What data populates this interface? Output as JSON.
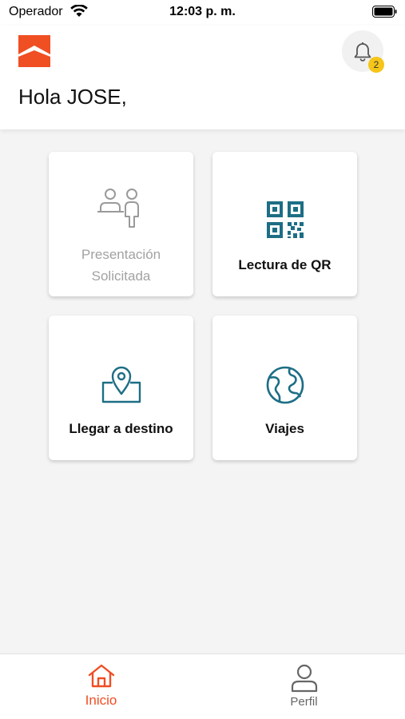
{
  "status_bar": {
    "carrier": "Operador",
    "time": "12:03 p. m."
  },
  "header": {
    "greeting": "Hola JOSE,",
    "notification_count": "2",
    "logo_icon": "brand-logo",
    "notification_icon": "bell-icon"
  },
  "cards": {
    "presentacion": {
      "label_line1": "Presentación",
      "label_line2": "Solicitada",
      "icon": "people-icon",
      "enabled": false
    },
    "qr": {
      "label": "Lectura de QR",
      "icon": "qr-code-icon",
      "enabled": true
    },
    "llegar": {
      "label": "Llegar a destino",
      "icon": "map-pin-icon",
      "enabled": true
    },
    "viajes": {
      "label": "Viajes",
      "icon": "globe-icon",
      "enabled": true
    }
  },
  "bottom_nav": {
    "items": [
      {
        "label": "Inicio",
        "icon": "home-icon",
        "active": true
      },
      {
        "label": "Perfil",
        "icon": "user-icon",
        "active": false
      }
    ]
  },
  "colors": {
    "brand": "#f04e23",
    "icon_teal": "#1d6e85",
    "badge": "#f5c518",
    "background": "#f4f4f4"
  }
}
